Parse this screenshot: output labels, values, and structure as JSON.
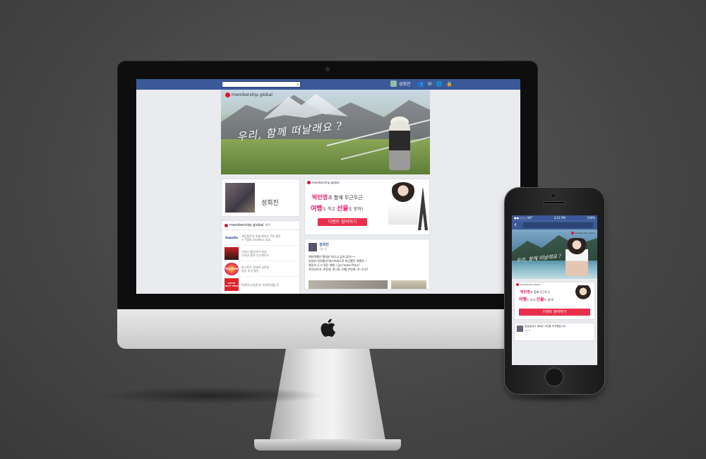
{
  "desktop": {
    "topbar": {
      "search_placeholder": "",
      "user_name": "성희진",
      "icons": [
        "friends-icon",
        "messages-icon",
        "notifications-icon",
        "privacy-icon"
      ]
    },
    "cover": {
      "brand": "membership global",
      "slogan": "우리, 함께 떠날래요 ?"
    },
    "profile": {
      "name": "성희진"
    },
    "ads": {
      "header": "membership global",
      "header_sub": "혜택",
      "items": [
        {
          "logo": "Expedia",
          "text1": "해신동반자 호텔 예약시 7% 할인",
          "text2": "+ T멤버 OnePass 유효"
        },
        {
          "logo": "",
          "text1": "신라스 롤리라아 정상",
          "text2": "신라면 블랙 업그레이드"
        },
        {
          "logo": "Tax Free",
          "text1": "하나투어 전세계 실판정",
          "text2": "정상 추가 할인"
        },
        {
          "logo": "LOTTE DUTY FREE",
          "text1": "면세면 쇼핑혼내! 롯데면세점 인",
          "text2": ""
        }
      ]
    },
    "event": {
      "brand": "membership global",
      "name": "박민영",
      "line1_suffix": "과 함께 두근두근",
      "travel": "여행",
      "mid": "도 하고 ",
      "gift": "선물",
      "tail": "도 받자!",
      "button": "이벤트 참여하기"
    },
    "post": {
      "author": "성희진",
      "time": "1분 전",
      "lines": [
        "해외여행은 했지만 떠나고 싶지 않아~~",
        "달달한 마카롱과 에스프레소로 피곤했던 여행이..!",
        "열정의 도시 멋진 여행 :) Je t'aime Paris!",
        "#안녕이여..#함께..#나와..여행 #연애..#..오지?"
      ]
    }
  },
  "mobile": {
    "status": {
      "carrier": "●●○○○ SKT",
      "time": "4:21 PM",
      "battery": "100%"
    },
    "cover": {
      "brand": "membership global",
      "slogan": "우리, 함께 떠날래요 ?"
    },
    "event": {
      "brand": "membership global",
      "name": "박민영",
      "line1_suffix": "과 함께 두근두근",
      "travel": "여행",
      "mid": "도 하고 ",
      "gift": "선물",
      "tail": "도 받자!",
      "button": "이벤트 참여하기"
    },
    "post": {
      "text": "홍길동님이 새로운 사진을 추가했습니다.",
      "time": "1분 전"
    }
  },
  "colors": {
    "facebook_blue": "#3b5998",
    "brand_red": "#e3132b",
    "event_pink": "#e6196d",
    "button_red": "#e8304c"
  }
}
